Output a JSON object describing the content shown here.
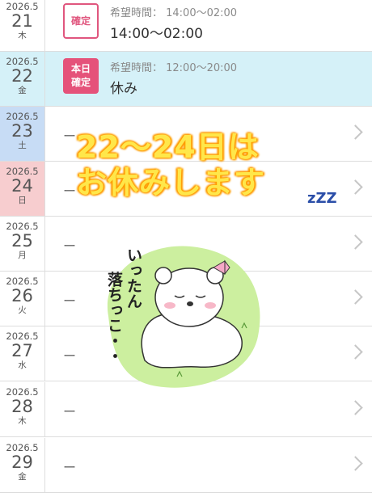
{
  "rows": [
    {
      "ym": "2026.5",
      "day": "21",
      "weekday": "木",
      "badge": [
        "確定"
      ],
      "request_label": "希望時間： 14:00〜02:00",
      "request_value": "14:00〜02:00"
    },
    {
      "ym": "2026.5",
      "day": "22",
      "weekday": "金",
      "badge": [
        "本日",
        "確定"
      ],
      "request_label": "希望時間： 12:00〜20:00",
      "request_value": "休み"
    },
    {
      "ym": "2026.5",
      "day": "23",
      "weekday": "土",
      "value": "ー"
    },
    {
      "ym": "2026.5",
      "day": "24",
      "weekday": "日",
      "value": "ー"
    },
    {
      "ym": "2026.5",
      "day": "25",
      "weekday": "月",
      "value": "ー"
    },
    {
      "ym": "2026.5",
      "day": "26",
      "weekday": "火",
      "value": "ー"
    },
    {
      "ym": "2026.5",
      "day": "27",
      "weekday": "水",
      "value": "ー"
    },
    {
      "ym": "2026.5",
      "day": "28",
      "weekday": "木",
      "value": "ー"
    },
    {
      "ym": "2026.5",
      "day": "29",
      "weekday": "金",
      "value": "ー"
    }
  ],
  "overlay": {
    "line1": "22〜24日は",
    "line2": "お休みします",
    "zzz": "zZZ"
  },
  "sticker": {
    "caption_col1": "いったん",
    "caption_col2": "落ちっこ・・"
  },
  "colors": {
    "accent_pink": "#e5527a",
    "today_bg": "#d5f1f8",
    "saturday_bg": "#c7dcf5",
    "sunday_bg": "#f7cdcf",
    "overlay_text": "#ffe74a",
    "sticker_bg": "#ccef9f"
  },
  "icons": [
    "chevron-right-icon",
    "sleeping-bear-sticker",
    "zzz-sleep-icon"
  ]
}
